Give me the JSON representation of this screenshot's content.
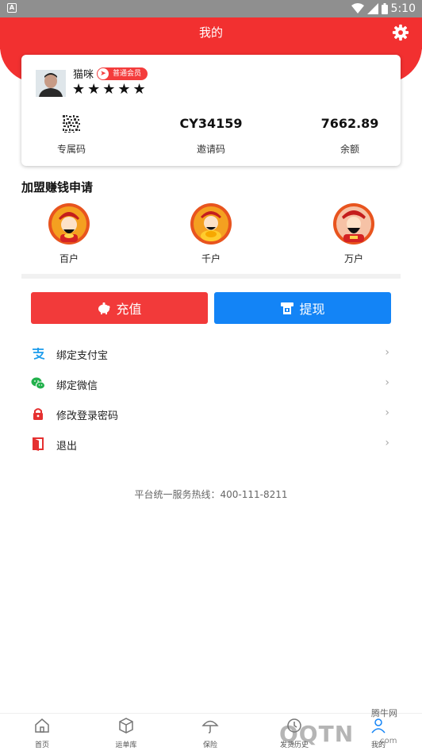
{
  "status_bar": {
    "app_icon": "A",
    "time": "5:10"
  },
  "header": {
    "title": "我的",
    "settings_icon": "gear-icon",
    "color": "#f23030"
  },
  "profile": {
    "name": "猫咪",
    "badge": "普通会员",
    "rating": 5,
    "stars": "★★★★★",
    "stats": [
      {
        "value": "",
        "label": "专属码"
      },
      {
        "value": "CY34159",
        "label": "邀请码"
      },
      {
        "value": "7662.89",
        "label": "余额"
      }
    ]
  },
  "franchise": {
    "title": "加盟赚钱申请",
    "tiers": [
      {
        "label": "百户"
      },
      {
        "label": "千户"
      },
      {
        "label": "万户"
      }
    ]
  },
  "actions": {
    "recharge": {
      "label": "充值",
      "color": "#f23a3a"
    },
    "withdraw": {
      "label": "提现",
      "color": "#1384f6"
    }
  },
  "menu": [
    {
      "label": "绑定支付宝",
      "icon": "alipay-icon"
    },
    {
      "label": "绑定微信",
      "icon": "wechat-icon"
    },
    {
      "label": "修改登录密码",
      "icon": "lock-icon"
    },
    {
      "label": "退出",
      "icon": "exit-icon"
    }
  ],
  "hotline": "平台统一服务热线：400-111-8211",
  "tabbar": [
    {
      "label": "首页",
      "icon": "home-icon"
    },
    {
      "label": "运单库",
      "icon": "box-icon"
    },
    {
      "label": "保险",
      "icon": "umbrella-icon"
    },
    {
      "label": "发货历史",
      "icon": "history-icon"
    },
    {
      "label": "我的",
      "icon": "user-icon"
    }
  ],
  "watermark": {
    "text": "QQTN",
    "small": "腾牛网",
    "url": ".com"
  }
}
